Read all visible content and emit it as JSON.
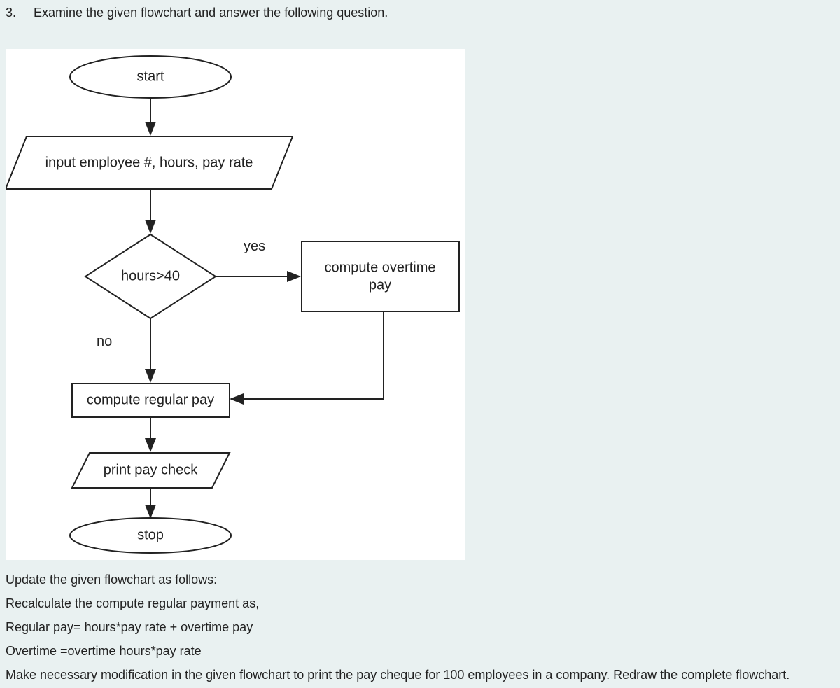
{
  "question": {
    "number": "3.",
    "prompt": "Examine the given flowchart and answer the following question."
  },
  "flowchart": {
    "start": "start",
    "input": "input employee #, hours, pay rate",
    "decision": "hours>40",
    "yes_label": "yes",
    "no_label": "no",
    "overtime_line1": "compute overtime",
    "overtime_line2": "pay",
    "regular": "compute regular pay",
    "print": "print pay check",
    "stop": "stop"
  },
  "followup": {
    "line1": "Update the given flowchart as follows:",
    "line2": "Recalculate the compute regular payment as,",
    "line3": "Regular pay= hours*pay rate + overtime pay",
    "line4": "Overtime =overtime hours*pay rate",
    "line5": "Make necessary modification in the given flowchart to print the pay cheque for  100 employees in a company. Redraw the complete flowchart."
  }
}
